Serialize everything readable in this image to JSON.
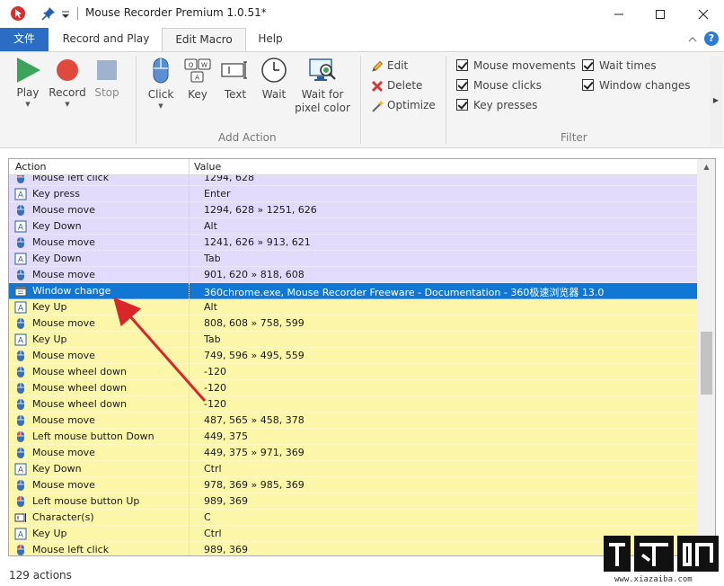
{
  "window": {
    "title": "Mouse Recorder Premium 1.0.51*"
  },
  "ribbon_tabs": [
    {
      "label": "文件"
    },
    {
      "label": "Record and Play"
    },
    {
      "label": "Edit Macro"
    },
    {
      "label": "Help"
    }
  ],
  "ribbon": {
    "play": "Play",
    "record": "Record",
    "stop": "Stop",
    "click": "Click",
    "key": "Key",
    "text": "Text",
    "wait": "Wait",
    "wait_for_1": "Wait for",
    "wait_for_2": "pixel color",
    "add_action": "Add Action",
    "edit": "Edit",
    "delete": "Delete",
    "optimize": "Optimize",
    "filter": "Filter",
    "help": "?",
    "filters": {
      "mouse_movements": "Mouse movements",
      "mouse_clicks": "Mouse clicks",
      "key_presses": "Key presses",
      "wait_times": "Wait times",
      "window_changes": "Window changes"
    }
  },
  "table": {
    "headers": {
      "action": "Action",
      "value": "Value"
    },
    "rows": [
      {
        "icon": "mouse-left-icon",
        "action": "Mouse left click",
        "value": "1294, 628",
        "color": "purple"
      },
      {
        "icon": "key-icon",
        "action": "Key press",
        "value": "Enter",
        "color": "purple"
      },
      {
        "icon": "mouse-icon",
        "action": "Mouse move",
        "value": "1294, 628 » 1251, 626",
        "color": "purple"
      },
      {
        "icon": "key-icon",
        "action": "Key Down",
        "value": "Alt",
        "color": "purple"
      },
      {
        "icon": "mouse-icon",
        "action": "Mouse move",
        "value": "1241, 626 » 913, 621",
        "color": "purple"
      },
      {
        "icon": "key-icon",
        "action": "Key Down",
        "value": "Tab",
        "color": "purple"
      },
      {
        "icon": "mouse-icon",
        "action": "Mouse move",
        "value": "901, 620 » 818, 608",
        "color": "purple"
      },
      {
        "icon": "window-icon",
        "action": "Window change",
        "value": "360chrome.exe, Mouse Recorder Freeware - Documentation - 360极速浏览器 13.0",
        "color": "selected"
      },
      {
        "icon": "key-icon",
        "action": "Key Up",
        "value": "Alt",
        "color": "yellow"
      },
      {
        "icon": "mouse-icon",
        "action": "Mouse move",
        "value": "808, 608 » 758, 599",
        "color": "yellow"
      },
      {
        "icon": "key-icon",
        "action": "Key Up",
        "value": "Tab",
        "color": "yellow"
      },
      {
        "icon": "mouse-icon",
        "action": "Mouse move",
        "value": "749, 596 » 495, 559",
        "color": "yellow"
      },
      {
        "icon": "mouse-icon",
        "action": "Mouse wheel down",
        "value": "-120",
        "color": "yellow"
      },
      {
        "icon": "mouse-icon",
        "action": "Mouse wheel down",
        "value": "-120",
        "color": "yellow"
      },
      {
        "icon": "mouse-icon",
        "action": "Mouse wheel down",
        "value": "-120",
        "color": "yellow"
      },
      {
        "icon": "mouse-icon",
        "action": "Mouse move",
        "value": "487, 565 » 458, 378",
        "color": "yellow"
      },
      {
        "icon": "mouse-left-icon",
        "action": "Left mouse button Down",
        "value": "449, 375",
        "color": "yellow"
      },
      {
        "icon": "mouse-icon",
        "action": "Mouse move",
        "value": "449, 375 » 971, 369",
        "color": "yellow"
      },
      {
        "icon": "key-icon",
        "action": "Key Down",
        "value": "Ctrl",
        "color": "yellow"
      },
      {
        "icon": "mouse-icon",
        "action": "Mouse move",
        "value": "978, 369 » 985, 369",
        "color": "yellow"
      },
      {
        "icon": "mouse-left-icon",
        "action": "Left mouse button Up",
        "value": "989, 369",
        "color": "yellow"
      },
      {
        "icon": "text-icon",
        "action": "Character(s)",
        "value": "C",
        "color": "yellow"
      },
      {
        "icon": "key-icon",
        "action": "Key Up",
        "value": "Ctrl",
        "color": "yellow"
      },
      {
        "icon": "mouse-left-icon",
        "action": "Mouse left click",
        "value": "989, 369",
        "color": "yellow"
      }
    ]
  },
  "status": {
    "count": "129 actions"
  },
  "watermark": {
    "site": "www.xiazaiba.com"
  },
  "colors": {
    "accent": "#2b6cc4",
    "selected_row": "#1177d4",
    "purple_row": "#e3dbfb",
    "yellow_row": "#fbf6a8",
    "annotation_arrow": "#d9262b"
  }
}
